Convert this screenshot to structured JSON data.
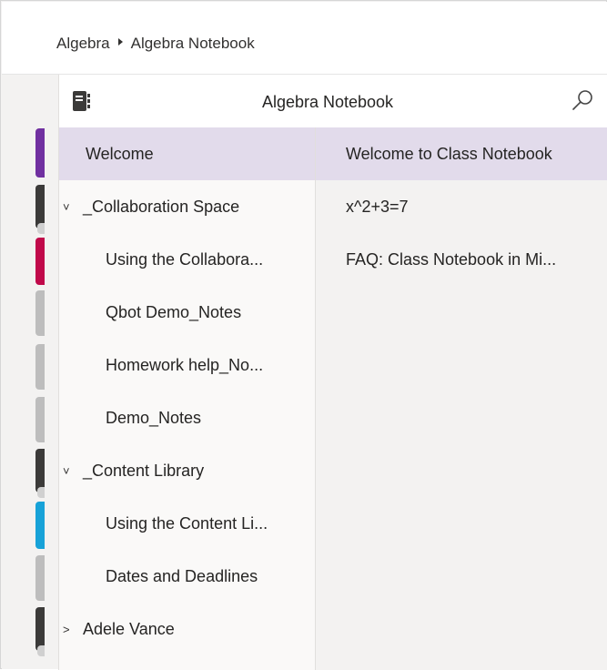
{
  "breadcrumb": {
    "parent": "Algebra",
    "current": "Algebra Notebook"
  },
  "notebook": {
    "title": "Algebra Notebook",
    "icon": "notebook-icon",
    "search_icon": "search-icon"
  },
  "sections": [
    {
      "label": "Welcome",
      "type": "section",
      "selected": true,
      "color": "#7030a0"
    },
    {
      "label": "_Collaboration Space",
      "type": "group",
      "expanded": true,
      "chevron": "˅"
    },
    {
      "label": "Using the Collabora...",
      "type": "section",
      "color": "#c0094a"
    },
    {
      "label": "Qbot Demo_Notes",
      "type": "section",
      "color": "#bdbdbd"
    },
    {
      "label": "Homework help_No...",
      "type": "section",
      "color": "#bdbdbd"
    },
    {
      "label": "Demo_Notes",
      "type": "section",
      "color": "#bdbdbd"
    },
    {
      "label": "_Content Library",
      "type": "group",
      "expanded": true,
      "chevron": "˅"
    },
    {
      "label": "Using the Content Li...",
      "type": "section",
      "color": "#17a2d8"
    },
    {
      "label": "Dates and Deadlines",
      "type": "section",
      "color": "#bdbdbd"
    },
    {
      "label": "Adele Vance",
      "type": "group",
      "expanded": false,
      "chevron": ">"
    }
  ],
  "pages": [
    {
      "label": "Welcome to Class Notebook",
      "selected": true
    },
    {
      "label": "x^2+3=7"
    },
    {
      "label": "FAQ: Class Notebook in Mi..."
    }
  ],
  "colors": {
    "accent": "#7030a0",
    "selected_bg": "#e2dbeb",
    "group_tab": "#3b3a39"
  }
}
